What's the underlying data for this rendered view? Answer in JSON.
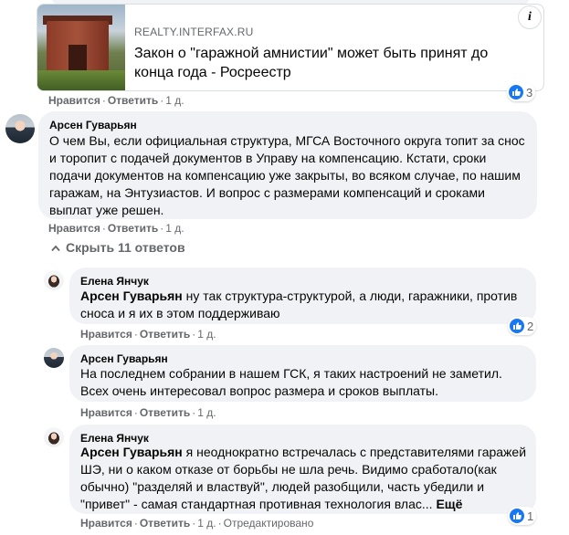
{
  "link_preview": {
    "domain": "REALTY.INTERFAX.RU",
    "title": "Закон о \"гаражной амнистии\" может быть принят до конца года - Росреестр",
    "info_glyph": "i",
    "like_count": "3"
  },
  "actions": {
    "like": "Нравится",
    "reply": "Ответить",
    "edited": "Отредактировано",
    "separator": "·"
  },
  "comments": [
    {
      "author": "Арсен Гуварьян",
      "text": "О чем Вы, если официальная структура, МГСА Восточного округа топит за снос и торопит с подачей документов в Управу на компенсацию. Кстати, сроки подачи документов на компенсацию уже закрыты, во всяком случае, по нашим гаражам, на Энтузиастов. И вопрос с размерами компенсаций и сроками выплат уже решен.",
      "time": "1 д."
    }
  ],
  "replies_toggle": "Скрыть 11 ответов",
  "replies": [
    {
      "author": "Елена Янчук",
      "mention": "Арсен Гуварьян",
      "text": " ну так структура-структурой, а люди, гаражники, против сноса и я их в этом поддерживаю",
      "time": "1 д.",
      "like_count": "2"
    },
    {
      "author": "Арсен Гуварьян",
      "text": "На последнем собрании в нашем ГСК, я таких настроений не заметил. Всех очень интересовал вопрос размера и сроков выплаты.",
      "time": "1 д."
    },
    {
      "author": "Елена Янчук",
      "mention": "Арсен Гуварьян",
      "text": " я неоднократно встречалась с представителями гаражей ШЭ, ни о каком отказе от борьбы не шла речь. Видимо сработало(как обычно) \"разделяй и властвуй\", людей разобщили, часть убедили и \"привет\" - самая стандартная противная технология влас...",
      "more": "Ещё",
      "time": "1 д.",
      "like_count": "1"
    }
  ],
  "colors": {
    "bubble": "#f0f2f5",
    "secondary_text": "#65676b",
    "like_blue": "#1877f2"
  }
}
